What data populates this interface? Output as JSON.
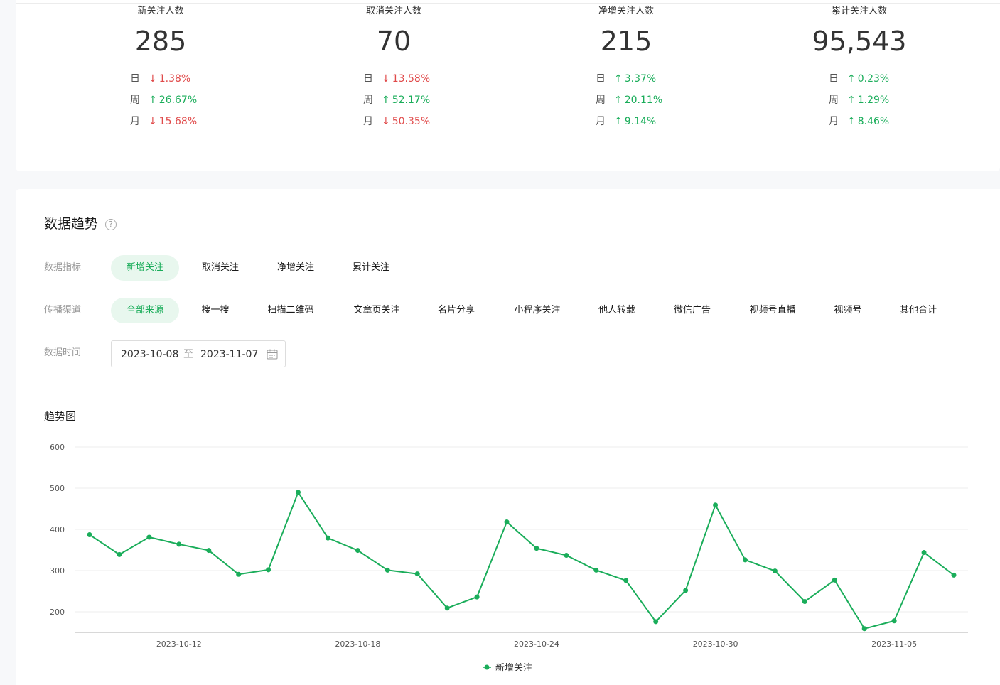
{
  "stats": [
    {
      "label": "新关注人数",
      "value": "285",
      "changes": [
        {
          "period": "日",
          "dir": "down",
          "arrow": "↓",
          "pct": "1.38%"
        },
        {
          "period": "周",
          "dir": "up",
          "arrow": "↑",
          "pct": "26.67%"
        },
        {
          "period": "月",
          "dir": "down",
          "arrow": "↓",
          "pct": "15.68%"
        }
      ]
    },
    {
      "label": "取消关注人数",
      "value": "70",
      "changes": [
        {
          "period": "日",
          "dir": "down",
          "arrow": "↓",
          "pct": "13.58%"
        },
        {
          "period": "周",
          "dir": "up",
          "arrow": "↑",
          "pct": "52.17%"
        },
        {
          "period": "月",
          "dir": "down",
          "arrow": "↓",
          "pct": "50.35%"
        }
      ]
    },
    {
      "label": "净增关注人数",
      "value": "215",
      "changes": [
        {
          "period": "日",
          "dir": "up",
          "arrow": "↑",
          "pct": "3.37%"
        },
        {
          "period": "周",
          "dir": "up",
          "arrow": "↑",
          "pct": "20.11%"
        },
        {
          "period": "月",
          "dir": "up",
          "arrow": "↑",
          "pct": "9.14%"
        }
      ]
    },
    {
      "label": "累计关注人数",
      "value": "95,543",
      "changes": [
        {
          "period": "日",
          "dir": "up",
          "arrow": "↑",
          "pct": "0.23%"
        },
        {
          "period": "周",
          "dir": "up",
          "arrow": "↑",
          "pct": "1.29%"
        },
        {
          "period": "月",
          "dir": "up",
          "arrow": "↑",
          "pct": "8.46%"
        }
      ]
    }
  ],
  "trend": {
    "title": "数据趋势",
    "help_icon": "question-circle-icon",
    "metric_label": "数据指标",
    "metrics": [
      "新增关注",
      "取消关注",
      "净增关注",
      "累计关注"
    ],
    "metric_active": 0,
    "channel_label": "传播渠道",
    "channels": [
      "全部来源",
      "搜一搜",
      "扫描二维码",
      "文章页关注",
      "名片分享",
      "小程序关注",
      "他人转载",
      "微信广告",
      "视频号直播",
      "视频号",
      "其他合计"
    ],
    "channel_active": 0,
    "date_label": "数据时间",
    "date_start": "2023-10-08",
    "date_sep": "至",
    "date_end": "2023-11-07",
    "calendar_icon": "calendar-icon",
    "chart_title": "趋势图"
  },
  "colors": {
    "accent": "#1aad5a",
    "down": "#e04a4a",
    "active_bg": "#e8f7ee"
  },
  "chart_data": {
    "type": "line",
    "title": "",
    "xlabel": "",
    "ylabel": "",
    "ylim": [
      150,
      600
    ],
    "yticks": [
      200,
      300,
      400,
      500,
      600
    ],
    "x": [
      "2023-10-09",
      "2023-10-10",
      "2023-10-11",
      "2023-10-12",
      "2023-10-13",
      "2023-10-14",
      "2023-10-15",
      "2023-10-16",
      "2023-10-17",
      "2023-10-18",
      "2023-10-19",
      "2023-10-20",
      "2023-10-21",
      "2023-10-22",
      "2023-10-23",
      "2023-10-24",
      "2023-10-25",
      "2023-10-26",
      "2023-10-27",
      "2023-10-28",
      "2023-10-29",
      "2023-10-30",
      "2023-10-31",
      "2023-11-01",
      "2023-11-02",
      "2023-11-03",
      "2023-11-04",
      "2023-11-05",
      "2023-11-06",
      "2023-11-07"
    ],
    "xtick_labels": [
      "2023-10-12",
      "2023-10-18",
      "2023-10-24",
      "2023-10-30",
      "2023-11-05"
    ],
    "series": [
      {
        "name": "新增关注",
        "color": "#1aad5a",
        "values": [
          387,
          339,
          381,
          364,
          349,
          291,
          302,
          490,
          379,
          349,
          301,
          292,
          209,
          236,
          418,
          354,
          337,
          301,
          276,
          176,
          252,
          459,
          326,
          299,
          225,
          277,
          159,
          178,
          344,
          289
        ]
      }
    ],
    "grid": true,
    "legend": "bottom-center"
  }
}
